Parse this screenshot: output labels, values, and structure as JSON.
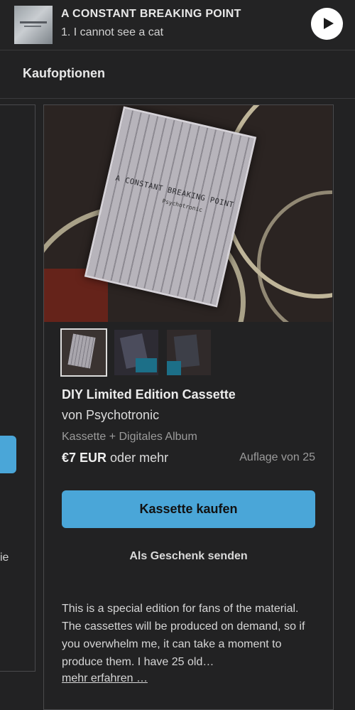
{
  "player": {
    "album_title": "A CONSTANT BREAKING POINT",
    "track": "1. I cannot see a cat",
    "icons": {
      "play": "play-icon"
    }
  },
  "section": {
    "title": "Kaufoptionen"
  },
  "prev_card": {
    "partial_text": "ie"
  },
  "product": {
    "cover_text": "A CONSTANT BREAKING POINT",
    "cover_sub": "Psychotronic",
    "title": "DIY Limited Edition Cassette",
    "artist": "von Psychotronic",
    "format": "Kassette + Digitales Album",
    "price": "€7 EUR",
    "price_suffix": "oder mehr",
    "edition": "Auflage von 25",
    "buy_label": "Kassette kaufen",
    "gift_label": "Als Geschenk senden",
    "description": "This is a special edition for fans of the material. The cassettes will be produced on demand, so if you overwhelm me, it can take a moment to produce them. I have 25 old…",
    "more_label": "mehr erfahren …"
  },
  "colors": {
    "accent": "#4aa6d8",
    "background": "#222223"
  }
}
